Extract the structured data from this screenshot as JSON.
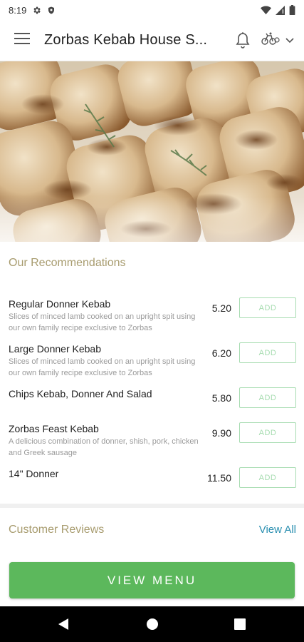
{
  "status_bar": {
    "time": "8:19",
    "icons": [
      "gear-icon",
      "shield-icon",
      "wifi-icon",
      "signal-icon",
      "battery-icon"
    ]
  },
  "app_bar": {
    "title": "Zorbas Kebab House S...",
    "icons": [
      "hamburger-menu-icon",
      "bell-icon",
      "bikes-icon",
      "chevron-down-icon"
    ]
  },
  "recommendations": {
    "title": "Our Recommendations",
    "add_label": "ADD",
    "items": [
      {
        "name": "Regular Donner Kebab",
        "description": "Slices of minced lamb cooked on an upright spit using our own family recipe exclusive to Zorbas",
        "price": "5.20"
      },
      {
        "name": "Large Donner Kebab",
        "description": "Slices of minced lamb cooked on an upright spit using our own family recipe exclusive to Zorbas",
        "price": "6.20"
      },
      {
        "name": "Chips Kebab, Donner And Salad",
        "description": "",
        "price": "5.80"
      },
      {
        "name": "Zorbas Feast Kebab",
        "description": "A delicious combination of donner, shish, pork, chicken and Greek sausage",
        "price": "9.90"
      },
      {
        "name": "14\" Donner",
        "description": "",
        "price": "11.50"
      }
    ]
  },
  "reviews": {
    "title": "Customer Reviews",
    "view_all": "View All"
  },
  "view_menu": {
    "label": "VIEW MENU"
  },
  "colors": {
    "accent_green": "#5cb85c",
    "add_border": "#a6dcb0",
    "section_title": "#a89c6f",
    "link_blue": "#2a8fb0"
  },
  "nav_bar": {
    "icons": [
      "back-icon",
      "home-icon",
      "recents-icon"
    ]
  }
}
